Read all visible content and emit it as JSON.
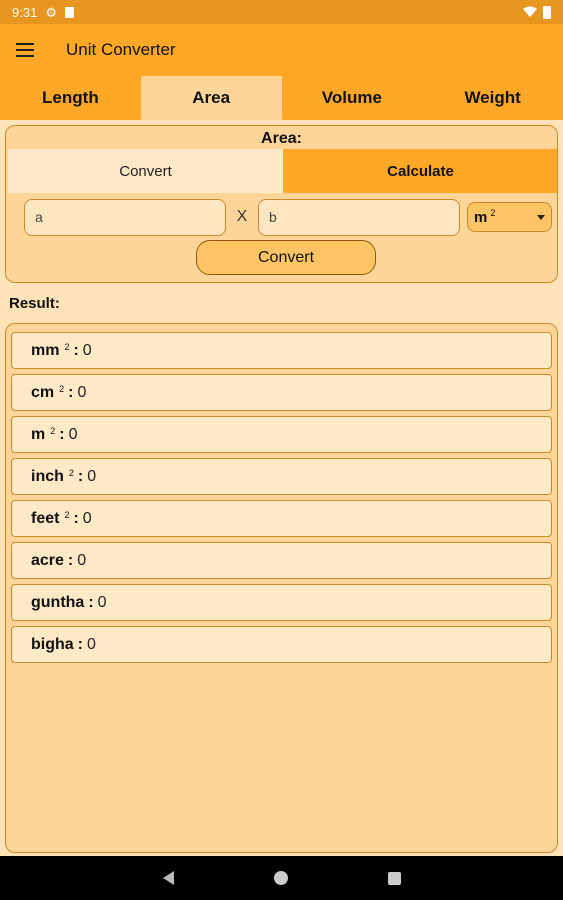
{
  "status_bar": {
    "time": "9:31",
    "icons": [
      "gear-icon",
      "sd-card-icon",
      "wifi-icon",
      "battery-icon"
    ]
  },
  "app_bar": {
    "menu_icon": "menu-icon",
    "title": "Unit Converter"
  },
  "tabs": [
    {
      "label": "Length",
      "active": false
    },
    {
      "label": "Area",
      "active": true
    },
    {
      "label": "Volume",
      "active": false
    },
    {
      "label": "Weight",
      "active": false
    }
  ],
  "area_card": {
    "title": "Area:",
    "mode_convert": "Convert",
    "mode_calculate": "Calculate",
    "active_mode": "Calculate",
    "input_a_placeholder": "a",
    "times_symbol": "X",
    "input_b_placeholder": "b",
    "unit_selected": "m",
    "unit_superscript": "2",
    "convert_button": "Convert"
  },
  "result_label": "Result:",
  "results": [
    {
      "unit": "mm",
      "sup": "2",
      "sep": ":",
      "value": "0"
    },
    {
      "unit": "cm",
      "sup": "2",
      "sep": ":",
      "value": "0"
    },
    {
      "unit": "m",
      "sup": "2",
      "sep": ":",
      "value": "0"
    },
    {
      "unit": "inch",
      "sup": "2",
      "sep": ":",
      "value": "0"
    },
    {
      "unit": "feet",
      "sup": "2",
      "sep": ":",
      "value": "0"
    },
    {
      "unit": "acre",
      "sup": "",
      "sep": ":",
      "value": "0"
    },
    {
      "unit": "guntha",
      "sup": "",
      "sep": ":",
      "value": "0"
    },
    {
      "unit": "bigha",
      "sup": "",
      "sep": ":",
      "value": "0"
    }
  ],
  "nav_bar": {
    "icons": [
      "back-icon",
      "home-icon",
      "recents-icon"
    ]
  },
  "colors": {
    "status_bar": "#E6951F",
    "primary": "#FFA726",
    "card": "#FFD59A",
    "background": "#FFE3B8",
    "border": "#C98A2E"
  }
}
